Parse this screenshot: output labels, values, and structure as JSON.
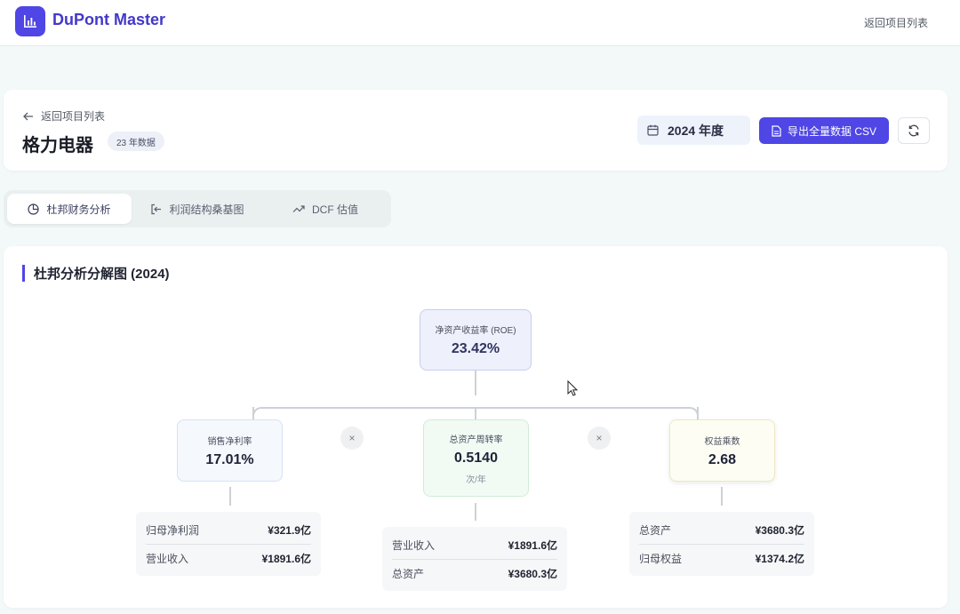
{
  "app": {
    "name": "DuPont Master",
    "top_back_label": "返回项目列表"
  },
  "header": {
    "back_label": "返回项目列表",
    "company": "格力电器",
    "data_badge": "23 年数据",
    "year": "2024 年度",
    "export_label": "导出全量数据 CSV"
  },
  "tabs": [
    {
      "label": "杜邦财务分析",
      "icon": "pie-chart-icon",
      "active": true
    },
    {
      "label": "利润结构桑基图",
      "icon": "sign-in-icon",
      "active": false
    },
    {
      "label": "DCF 估值",
      "icon": "trending-up-icon",
      "active": false
    }
  ],
  "section_title": "杜邦分析分解图 (2024)",
  "tree": {
    "roe": {
      "label": "净资产收益率 (ROE)",
      "value": "23.42%"
    },
    "net_margin": {
      "label": "销售净利率",
      "value": "17.01%",
      "items": [
        {
          "label": "归母净利润",
          "value": "¥321.9亿"
        },
        {
          "label": "营业收入",
          "value": "¥1891.6亿"
        }
      ]
    },
    "asset_turnover": {
      "label": "总资产周转率",
      "value": "0.5140",
      "unit": "次/年",
      "items": [
        {
          "label": "营业收入",
          "value": "¥1891.6亿"
        },
        {
          "label": "总资产",
          "value": "¥3680.3亿"
        }
      ]
    },
    "equity_multiplier": {
      "label": "权益乘数",
      "value": "2.68",
      "items": [
        {
          "label": "总资产",
          "value": "¥3680.3亿"
        },
        {
          "label": "归母权益",
          "value": "¥1374.2亿"
        }
      ]
    },
    "operator": "×"
  },
  "colors": {
    "accent": "#4f46e5"
  }
}
